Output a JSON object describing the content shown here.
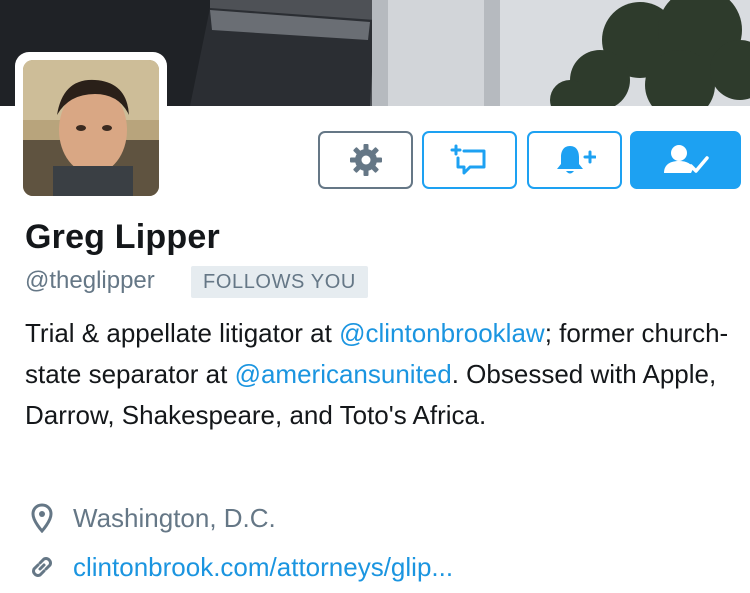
{
  "profile": {
    "name": "Greg Lipper",
    "handle": "@theglipper",
    "follows_badge": "FOLLOWS YOU",
    "bio": {
      "text_1": "Trial & appellate litigator at ",
      "mention_1": "@clintonbrooklaw",
      "text_2": "; former church-state separator at ",
      "mention_2": "@americansunited",
      "text_3": ". Obsessed with Apple, Darrow, Shakespeare, and Toto's Africa."
    },
    "location": "Washington, D.C.",
    "website": "clintonbrook.com/attorneys/glip..."
  },
  "icons": {
    "settings": "gear-icon",
    "tweet_to": "compose-reply-icon",
    "notifications": "bell-plus-icon",
    "following": "person-check-icon",
    "location": "map-pin-icon",
    "link": "link-icon"
  },
  "colors": {
    "accent": "#1da1f2",
    "link": "#1b95e0",
    "secondary_text": "#657786",
    "badge_bg": "#e6ecf0"
  }
}
